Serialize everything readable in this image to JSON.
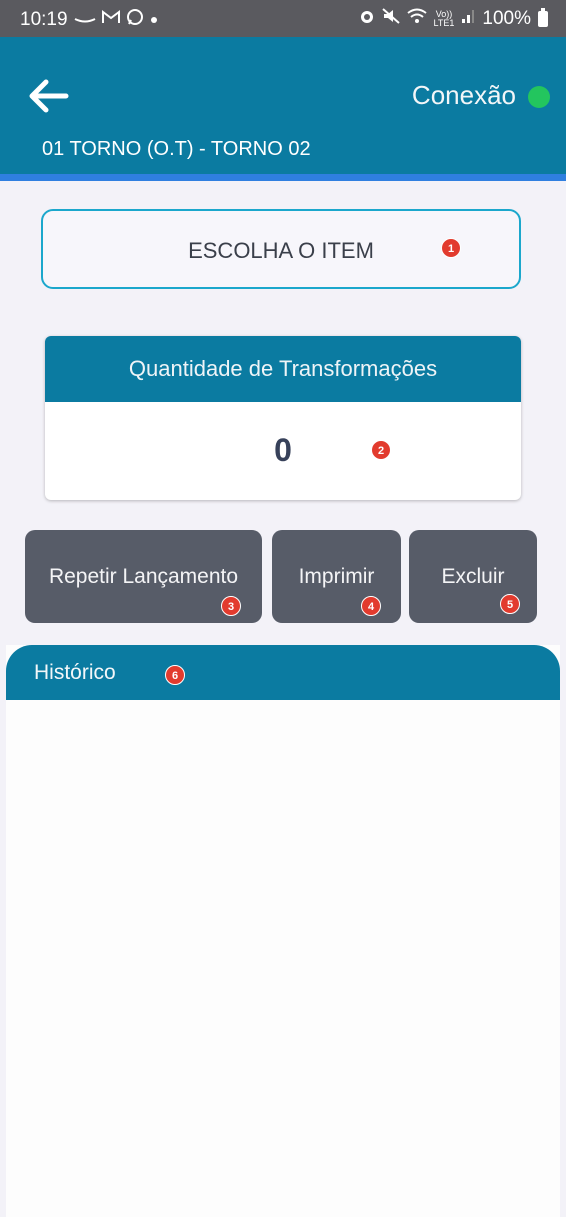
{
  "status_bar": {
    "time": "10:19",
    "left_icons": [
      "voicemail-icon",
      "gmail-icon",
      "whatsapp-icon",
      "dot-icon"
    ],
    "right_icons": [
      "alarm-icon",
      "mute-icon",
      "wifi-icon",
      "volte-icon",
      "signal-icon"
    ],
    "volte": "Vo))",
    "lte": "LTE1",
    "battery": "100%"
  },
  "header": {
    "connection_label": "Conexão",
    "connection_color": "#23c55e",
    "subtitle": "01 TORNO (O.T) - TORNO 02",
    "bg_color": "#0b7ba1"
  },
  "choose_item": {
    "label": "ESCOLHA O ITEM",
    "badge": "1"
  },
  "quantity": {
    "title": "Quantidade de Transformações",
    "value": "0",
    "badge": "2"
  },
  "actions": [
    {
      "label": "Repetir Lançamento",
      "badge": "3"
    },
    {
      "label": "Imprimir",
      "badge": "4"
    },
    {
      "label": "Excluir",
      "badge": "5"
    }
  ],
  "history": {
    "title": "Histórico",
    "badge": "6",
    "items": []
  }
}
